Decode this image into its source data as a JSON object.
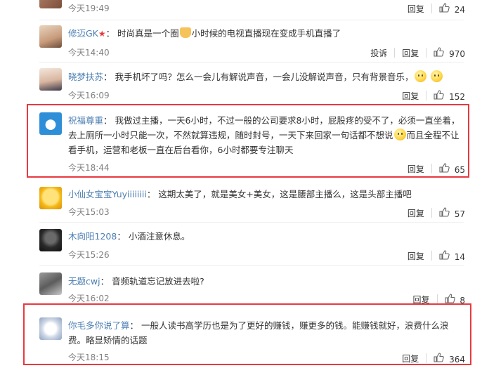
{
  "colors": {
    "author": "#4d7fb3",
    "highlight": "#e8393f",
    "time": "#808080"
  },
  "actions": {
    "report": "投诉",
    "reply": "回复"
  },
  "comments": [
    {
      "author": "",
      "text": "",
      "time": "今天19:49",
      "likes": "24"
    },
    {
      "author": "修迈GK",
      "badge": "★",
      "text_before": "时尚真是一个圈",
      "text_after": "小时候的电视直播现在变成手机直播了",
      "time": "今天14:40",
      "likes": "970",
      "report": true
    },
    {
      "author": "晓梦扶苏",
      "text": "我手机坏了吗？怎么一会儿有解说声音，一会儿没解说声音，只有背景音乐，",
      "time": "今天16:09",
      "likes": "152"
    },
    {
      "author": "祝福尊重",
      "text_before": "我做过主播，一天6小时，不过一般的公司要求8小时，屁股疼的受不了，必须一直坐着，去上厕所一小时只能一次，不然就算违规，随时封号，一天下来回家一句话都不想说",
      "text_after": "而且全程不让看手机，运营和老板一直在后台看你，6小时都要专注聊天",
      "time": "今天18:44",
      "likes": "65"
    },
    {
      "author": "小仙女宝宝Yuyiiiiiiii",
      "text": "这期太美了，就是美女+美女，这是腰部主播么，这是头部主播吧",
      "time": "今天15:03",
      "likes": "57"
    },
    {
      "author": "木向阳1208",
      "text": "小酒注意休息。",
      "time": "今天15:26",
      "likes": "14"
    },
    {
      "author": "无题cwj",
      "text": "音频轨道忘记放进去啦?",
      "time": "今天16:02",
      "likes": "8"
    },
    {
      "author": "你毛多你说了算",
      "text": "一般人读书高学历也是为了更好的赚钱，赚更多的钱。能赚钱就好，浪费什么浪费。略显矫情的话题",
      "time": "今天18:15",
      "likes": "364"
    }
  ]
}
